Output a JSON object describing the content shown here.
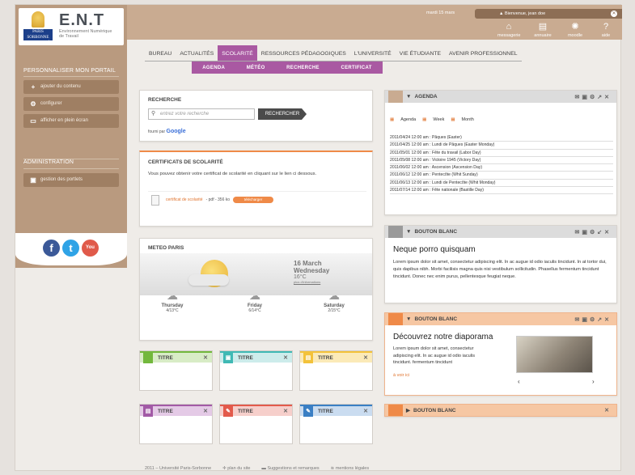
{
  "brand": {
    "title": "E.N.T",
    "subtitle": "Environnement Numérique de Travail",
    "crest_text": "PARIS SORBONNE UNIVERSITÉ"
  },
  "topbar": {
    "date": "mardi 15 mars",
    "welcome": "Bienvenue, jean doe",
    "icons": [
      {
        "label": "messagerie",
        "icon": "inbox-icon"
      },
      {
        "label": "annuaire",
        "icon": "contacts-icon"
      },
      {
        "label": "moodle",
        "icon": "moodle-icon"
      },
      {
        "label": "aide",
        "icon": "help-icon"
      }
    ]
  },
  "sidebar": {
    "heading_portal": "PERSONNALISER MON PORTAIL",
    "items": [
      {
        "label": "ajouter du contenu",
        "icon": "plus-icon"
      },
      {
        "label": "configurer",
        "icon": "gear-icon"
      },
      {
        "label": "afficher en plein écran",
        "icon": "monitor-icon"
      }
    ],
    "heading_admin": "ADMINISTRATION",
    "admin_items": [
      {
        "label": "gestion des portlets",
        "icon": "portlet-icon"
      }
    ],
    "social": [
      {
        "name": "facebook",
        "glyph": "f",
        "color": "#3b5998"
      },
      {
        "name": "twitter",
        "glyph": "t",
        "color": "#2fa3e6"
      },
      {
        "name": "youtube",
        "glyph": "You",
        "color": "#e05a4a"
      }
    ]
  },
  "nav": {
    "items": [
      "BUREAU",
      "ACTUALITÉS",
      "SCOLARITÉ",
      "RESSOURCES PÉDAGOGIQUES",
      "L'UNIVERSITÉ",
      "VIE ÉTUDIANTE",
      "AVENIR PROFESSIONNEL"
    ],
    "active": "SCOLARITÉ",
    "subitems": [
      "AGENDA",
      "MÉTÉO",
      "RECHERCHE",
      "CERTIFICAT"
    ]
  },
  "search": {
    "title": "RECHERCHE",
    "placeholder": "entrez votre recherche",
    "button": "RECHERCHER",
    "provider": "fourni par",
    "provider_name": "Google"
  },
  "certificat": {
    "title": "CERTIFICATS DE SCOLARITÉ",
    "text": "Vous pouvez obtenir votre certificat de scolarité en cliquant sur le lien ci dessous.",
    "file_link": "certificat de scolarité",
    "file_meta": "- pdf - 356 ko",
    "download": "télécharger"
  },
  "meteo": {
    "title": "METEO PARIS",
    "date": "16 March",
    "weekday": "Wednesday",
    "temp": "16°C",
    "more": "plus d'informations",
    "days": [
      {
        "day": "Thursday",
        "range": "4/13°C",
        "icon": "cloud-sun-icon"
      },
      {
        "day": "Friday",
        "range": "6/14°C",
        "icon": "cloud-sun-icon"
      },
      {
        "day": "Saturday",
        "range": "2/15°C",
        "icon": "cloud-icon"
      }
    ]
  },
  "widgets": [
    {
      "title": "TITRE",
      "color": "#72b83c"
    },
    {
      "title": "TITRE",
      "color": "#3fb9b4"
    },
    {
      "title": "TITRE",
      "color": "#f3c23a"
    },
    {
      "title": "TITRE",
      "color": "#a25aa6"
    },
    {
      "title": "TITRE",
      "color": "#e35a4b"
    },
    {
      "title": "TITRE",
      "color": "#3a7fc4"
    }
  ],
  "agenda": {
    "title": "AGENDA",
    "views": [
      "Agenda",
      "Week",
      "Month"
    ],
    "events": [
      "2011/04/24 12:00 am : Pâques (Easter)",
      "2011/04/25 12:00 am : Lundi de Pâques (Easter Monday)",
      "2011/05/01 12:00 am : Fête du travail (Labor Day)",
      "2011/05/08 12:00 am : Victoire 1945 (Victory Day)",
      "2011/06/02 12:00 am : Ascension (Ascension Day)",
      "2011/06/12 12:00 am : Pentecôte (Whit Sunday)",
      "2011/06/13 12:00 am : Lundi de Pentecôte (Whit Monday)",
      "2011/07/14 12:00 am : Fête nationale (Bastille Day)"
    ]
  },
  "bouton1": {
    "title": "BOUTON BLANC",
    "heading": "Neque porro quisquam",
    "text": "Lorem ipsum dolor sit amet, consectetur adipiscing elit. In ac augue id odio iaculis tincidunt. In at tortor dui, quis dapibus nibh. Morbi facilisis magna quis nisi vestibulum sollicitudin. Phasellus fermentum tincidunt tincidunt. Donec nec enim purus, pellentesque feugiat neque."
  },
  "bouton2": {
    "title": "BOUTON BLANC",
    "heading": "Découvrez notre diaporama",
    "text": "Lorem ipsum dolor sit amet, consectetur adipiscing elit. In ac augue id odio iaculis tincidunt. fermentum tincidunt",
    "link": "à voir ici"
  },
  "bouton3": {
    "title": "BOUTON BLANC"
  },
  "footer": {
    "copyright": "2011 – Université Paris-Sorbonne",
    "sitemap": "plan du site",
    "feedback": "Suggestions et remarques",
    "legal": "mentions légales"
  }
}
